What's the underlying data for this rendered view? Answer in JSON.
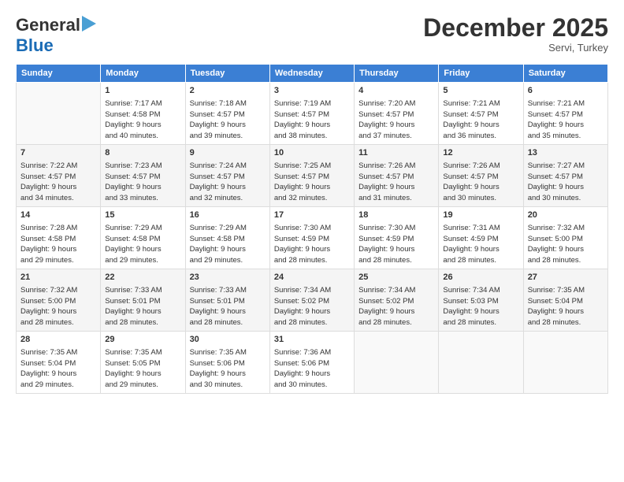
{
  "logo": {
    "line1": "General",
    "line2": "Blue",
    "arrow": "▶"
  },
  "title": "December 2025",
  "location": "Servi, Turkey",
  "days_of_week": [
    "Sunday",
    "Monday",
    "Tuesday",
    "Wednesday",
    "Thursday",
    "Friday",
    "Saturday"
  ],
  "weeks": [
    [
      {
        "num": "",
        "info": ""
      },
      {
        "num": "1",
        "info": "Sunrise: 7:17 AM\nSunset: 4:58 PM\nDaylight: 9 hours\nand 40 minutes."
      },
      {
        "num": "2",
        "info": "Sunrise: 7:18 AM\nSunset: 4:57 PM\nDaylight: 9 hours\nand 39 minutes."
      },
      {
        "num": "3",
        "info": "Sunrise: 7:19 AM\nSunset: 4:57 PM\nDaylight: 9 hours\nand 38 minutes."
      },
      {
        "num": "4",
        "info": "Sunrise: 7:20 AM\nSunset: 4:57 PM\nDaylight: 9 hours\nand 37 minutes."
      },
      {
        "num": "5",
        "info": "Sunrise: 7:21 AM\nSunset: 4:57 PM\nDaylight: 9 hours\nand 36 minutes."
      },
      {
        "num": "6",
        "info": "Sunrise: 7:21 AM\nSunset: 4:57 PM\nDaylight: 9 hours\nand 35 minutes."
      }
    ],
    [
      {
        "num": "7",
        "info": "Sunrise: 7:22 AM\nSunset: 4:57 PM\nDaylight: 9 hours\nand 34 minutes."
      },
      {
        "num": "8",
        "info": "Sunrise: 7:23 AM\nSunset: 4:57 PM\nDaylight: 9 hours\nand 33 minutes."
      },
      {
        "num": "9",
        "info": "Sunrise: 7:24 AM\nSunset: 4:57 PM\nDaylight: 9 hours\nand 32 minutes."
      },
      {
        "num": "10",
        "info": "Sunrise: 7:25 AM\nSunset: 4:57 PM\nDaylight: 9 hours\nand 32 minutes."
      },
      {
        "num": "11",
        "info": "Sunrise: 7:26 AM\nSunset: 4:57 PM\nDaylight: 9 hours\nand 31 minutes."
      },
      {
        "num": "12",
        "info": "Sunrise: 7:26 AM\nSunset: 4:57 PM\nDaylight: 9 hours\nand 30 minutes."
      },
      {
        "num": "13",
        "info": "Sunrise: 7:27 AM\nSunset: 4:57 PM\nDaylight: 9 hours\nand 30 minutes."
      }
    ],
    [
      {
        "num": "14",
        "info": "Sunrise: 7:28 AM\nSunset: 4:58 PM\nDaylight: 9 hours\nand 29 minutes."
      },
      {
        "num": "15",
        "info": "Sunrise: 7:29 AM\nSunset: 4:58 PM\nDaylight: 9 hours\nand 29 minutes."
      },
      {
        "num": "16",
        "info": "Sunrise: 7:29 AM\nSunset: 4:58 PM\nDaylight: 9 hours\nand 29 minutes."
      },
      {
        "num": "17",
        "info": "Sunrise: 7:30 AM\nSunset: 4:59 PM\nDaylight: 9 hours\nand 28 minutes."
      },
      {
        "num": "18",
        "info": "Sunrise: 7:30 AM\nSunset: 4:59 PM\nDaylight: 9 hours\nand 28 minutes."
      },
      {
        "num": "19",
        "info": "Sunrise: 7:31 AM\nSunset: 4:59 PM\nDaylight: 9 hours\nand 28 minutes."
      },
      {
        "num": "20",
        "info": "Sunrise: 7:32 AM\nSunset: 5:00 PM\nDaylight: 9 hours\nand 28 minutes."
      }
    ],
    [
      {
        "num": "21",
        "info": "Sunrise: 7:32 AM\nSunset: 5:00 PM\nDaylight: 9 hours\nand 28 minutes."
      },
      {
        "num": "22",
        "info": "Sunrise: 7:33 AM\nSunset: 5:01 PM\nDaylight: 9 hours\nand 28 minutes."
      },
      {
        "num": "23",
        "info": "Sunrise: 7:33 AM\nSunset: 5:01 PM\nDaylight: 9 hours\nand 28 minutes."
      },
      {
        "num": "24",
        "info": "Sunrise: 7:34 AM\nSunset: 5:02 PM\nDaylight: 9 hours\nand 28 minutes."
      },
      {
        "num": "25",
        "info": "Sunrise: 7:34 AM\nSunset: 5:02 PM\nDaylight: 9 hours\nand 28 minutes."
      },
      {
        "num": "26",
        "info": "Sunrise: 7:34 AM\nSunset: 5:03 PM\nDaylight: 9 hours\nand 28 minutes."
      },
      {
        "num": "27",
        "info": "Sunrise: 7:35 AM\nSunset: 5:04 PM\nDaylight: 9 hours\nand 28 minutes."
      }
    ],
    [
      {
        "num": "28",
        "info": "Sunrise: 7:35 AM\nSunset: 5:04 PM\nDaylight: 9 hours\nand 29 minutes."
      },
      {
        "num": "29",
        "info": "Sunrise: 7:35 AM\nSunset: 5:05 PM\nDaylight: 9 hours\nand 29 minutes."
      },
      {
        "num": "30",
        "info": "Sunrise: 7:35 AM\nSunset: 5:06 PM\nDaylight: 9 hours\nand 30 minutes."
      },
      {
        "num": "31",
        "info": "Sunrise: 7:36 AM\nSunset: 5:06 PM\nDaylight: 9 hours\nand 30 minutes."
      },
      {
        "num": "",
        "info": ""
      },
      {
        "num": "",
        "info": ""
      },
      {
        "num": "",
        "info": ""
      }
    ]
  ]
}
